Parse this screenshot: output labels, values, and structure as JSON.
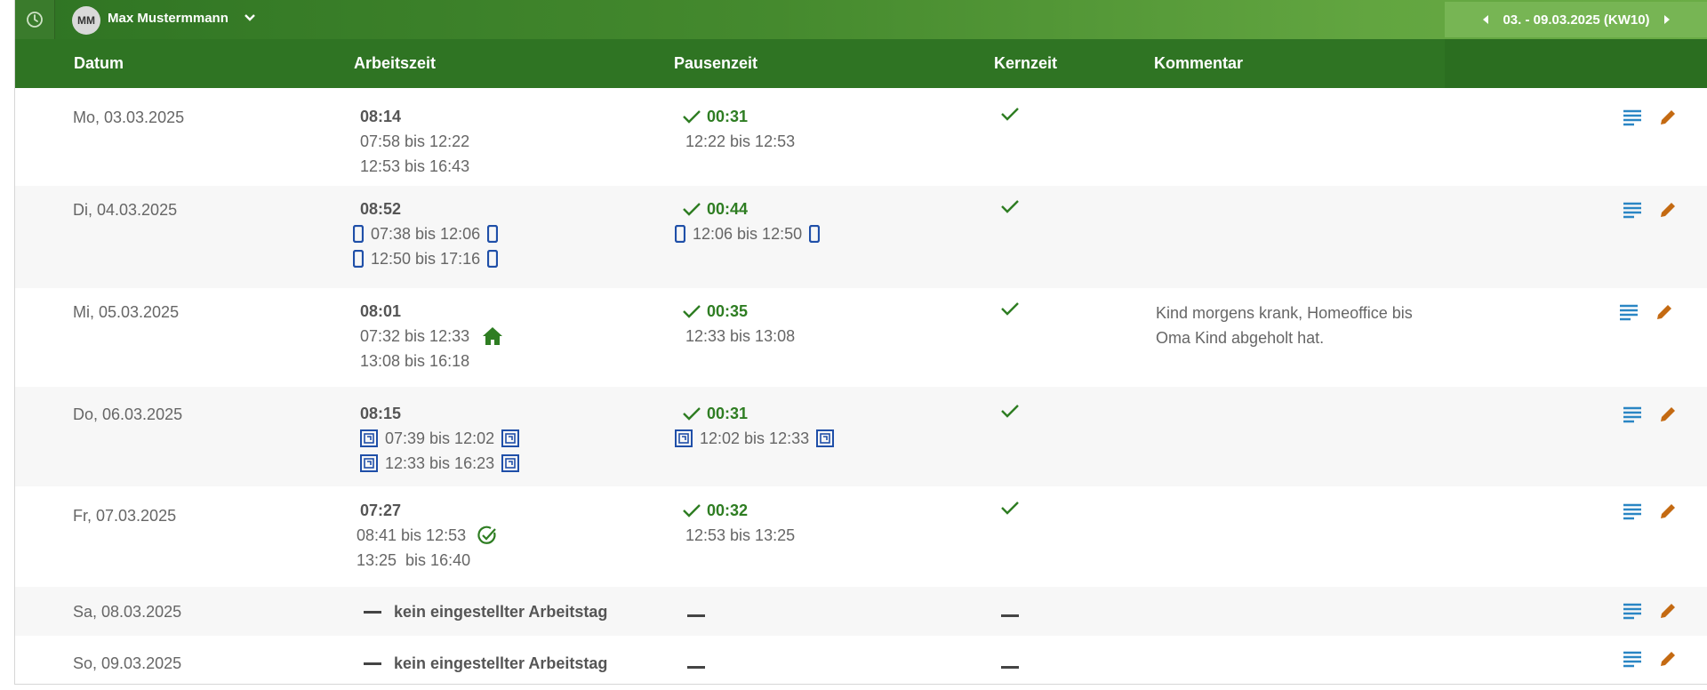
{
  "topbar": {
    "avatar_initials": "MM",
    "user_name": "Max Mustermmann",
    "week_label": "03. - 09.03.2025 (KW10)"
  },
  "columns": {
    "datum": "Datum",
    "arbeitszeit": "Arbeitszeit",
    "pausenzeit": "Pausenzeit",
    "kernzeit": "Kernzeit",
    "kommentar": "Kommentar"
  },
  "rows": [
    {
      "date": "Mo, 03.03.2025",
      "work_total": "08:14",
      "work_lines": [
        "07:58 bis 12:22",
        "12:53 bis 16:43"
      ],
      "pause_total": "00:31",
      "pause_line": "12:22 bis 12:53",
      "comment": ""
    },
    {
      "date": "Di, 04.03.2025",
      "work_total": "08:52",
      "work_lines": [
        "07:38 bis 12:06",
        "12:50 bis 17:16"
      ],
      "pause_total": "00:44",
      "pause_line": "12:06 bis 12:50",
      "comment": ""
    },
    {
      "date": "Mi, 05.03.2025",
      "work_total": "08:01",
      "work_lines": [
        "07:32 bis 12:33",
        "13:08 bis 16:18"
      ],
      "pause_total": "00:35",
      "pause_line": "12:33 bis 13:08",
      "comment": "Kind morgens krank, Homeoffice bis Oma Kind abgeholt hat."
    },
    {
      "date": "Do, 06.03.2025",
      "work_total": "08:15",
      "work_lines": [
        "07:39 bis 12:02",
        "12:33 bis 16:23"
      ],
      "pause_total": "00:31",
      "pause_line": "12:02 bis 12:33",
      "comment": ""
    },
    {
      "date": "Fr, 07.03.2025",
      "work_total": "07:27",
      "work_lines": [
        "08:41 bis 12:53",
        "13:25  bis 16:40"
      ],
      "pause_total": "00:32",
      "pause_line": "12:53 bis 13:25",
      "comment": ""
    },
    {
      "date": "Sa, 08.03.2025",
      "work_text": "kein eingestellter Arbeitstag"
    },
    {
      "date": "So, 09.03.2025",
      "work_text": "kein eingestellter Arbeitstag"
    }
  ],
  "colors": {
    "primary_green": "#2f7423",
    "accent_green": "#77b554",
    "check_green": "#2e7d22",
    "mobile_blue": "#1f4fa8",
    "detail_icon_blue": "#2a86c4",
    "edit_icon_orange": "#c46a12"
  },
  "icons": {
    "clock": "clock-icon",
    "chevron": "chevron-down-icon",
    "prev": "caret-left-icon",
    "next": "caret-right-icon",
    "check": "check-icon",
    "mobile": "mobile-icon",
    "terminal": "terminal-icon",
    "home": "home-icon",
    "approved": "check-circle-icon",
    "details": "details-icon",
    "edit": "pencil-icon"
  }
}
